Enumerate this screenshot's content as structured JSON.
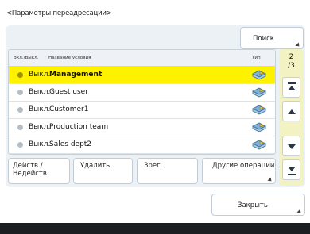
{
  "title": "<Параметры переадресации>",
  "search_button": "Поиск",
  "list": {
    "headers": {
      "on_off": "Вкл./Выкл.",
      "condition_name": "Название условия",
      "type": "Тип"
    },
    "rows": [
      {
        "status": "Выкл.",
        "name": "Management",
        "selected": true
      },
      {
        "status": "Выкл.",
        "name": "Guest user",
        "selected": false
      },
      {
        "status": "Выкл.",
        "name": "Customer1",
        "selected": false
      },
      {
        "status": "Выкл.",
        "name": "Production team",
        "selected": false
      },
      {
        "status": "Выкл.",
        "name": "Sales dept2",
        "selected": false
      }
    ]
  },
  "pager": {
    "current": "2",
    "total": "/3"
  },
  "actions": {
    "toggle": "Действ./ Недейств.",
    "delete": "Удалить",
    "register": "Зрег.",
    "other_ops": "Другие операции"
  },
  "close_button": "Закрыть",
  "colors": {
    "selected_row": "#fff200",
    "panel_bg": "#ecf1f6",
    "scroll_panel_bg": "#f3f2c2",
    "footer_bar": "#1b1d20"
  }
}
